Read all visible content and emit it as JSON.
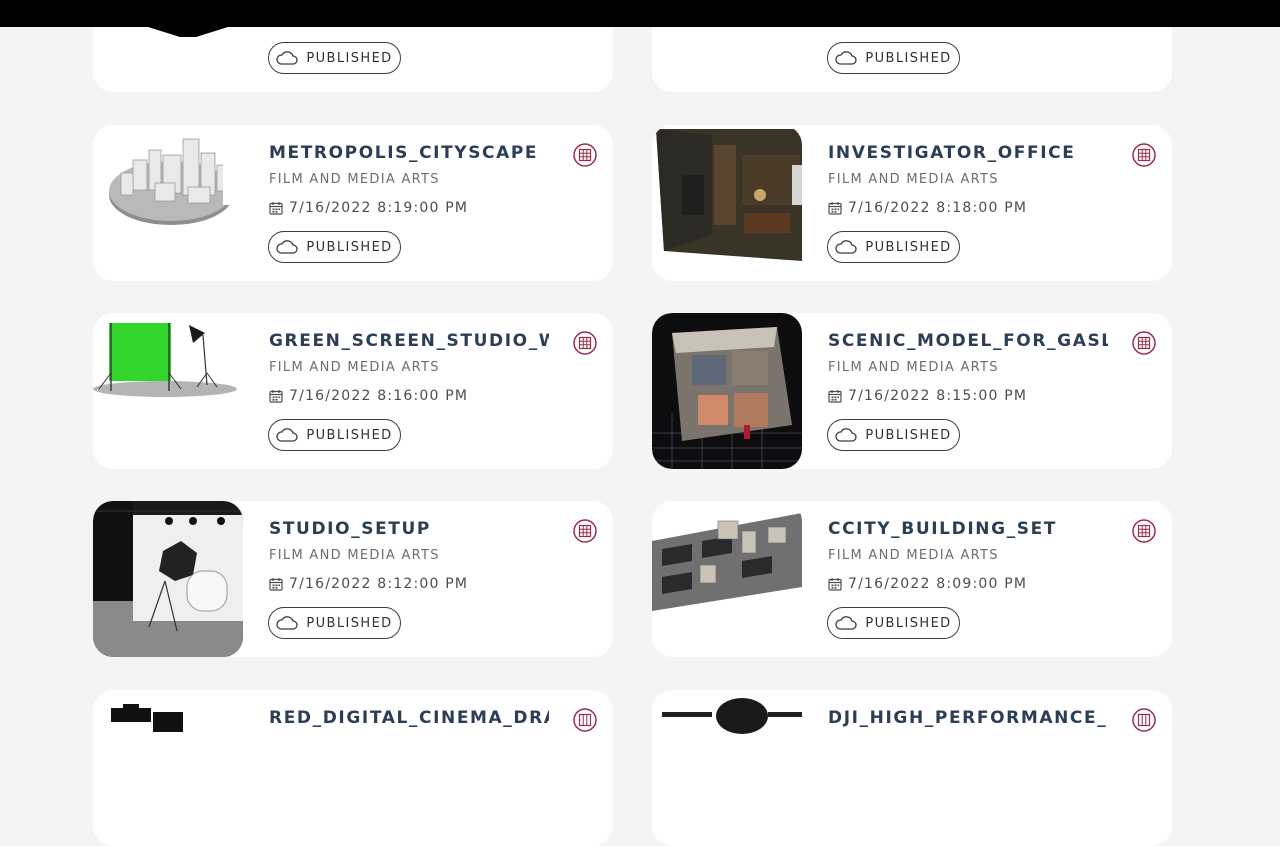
{
  "colors": {
    "page_bg": "#f4f4f5",
    "card_bg": "#ffffff",
    "title": "#2c3e55",
    "accent_icon": "#9b2b4a"
  },
  "status_label": "PUBLISHED",
  "items": [
    {
      "title": "",
      "category": "",
      "date": "",
      "status": "PUBLISHED"
    },
    {
      "title": "",
      "category": "",
      "date": "",
      "status": "PUBLISHED"
    },
    {
      "title": "METROPOLIS_CITYSCAPE",
      "category": "FILM AND MEDIA ARTS",
      "date": "7/16/2022 8:19:00 PM",
      "status": "PUBLISHED",
      "thumb_icon": "city-model-thumbnail"
    },
    {
      "title": "INVESTIGATOR_OFFICE",
      "category": "FILM AND MEDIA ARTS",
      "date": "7/16/2022 8:18:00 PM",
      "status": "PUBLISHED",
      "thumb_icon": "office-room-thumbnail"
    },
    {
      "title": "GREEN_SCREEN_STUDIO_W...",
      "category": "FILM AND MEDIA ARTS",
      "date": "7/16/2022 8:16:00 PM",
      "status": "PUBLISHED",
      "thumb_icon": "green-screen-thumbnail"
    },
    {
      "title": "SCENIC_MODEL_FOR_GASL...",
      "category": "FILM AND MEDIA ARTS",
      "date": "7/16/2022 8:15:00 PM",
      "status": "PUBLISHED",
      "thumb_icon": "scenic-model-thumbnail"
    },
    {
      "title": "STUDIO_SETUP",
      "category": "FILM AND MEDIA ARTS",
      "date": "7/16/2022 8:12:00 PM",
      "status": "PUBLISHED",
      "thumb_icon": "studio-setup-thumbnail"
    },
    {
      "title": "CCITY_BUILDING_SET",
      "category": "FILM AND MEDIA ARTS",
      "date": "7/16/2022 8:09:00 PM",
      "status": "PUBLISHED",
      "thumb_icon": "building-set-thumbnail"
    },
    {
      "title": "RED_DIGITAL_CINEMA_DRA...",
      "category": "",
      "date": "",
      "status": "",
      "thumb_icon": "camera-thumbnail"
    },
    {
      "title": "DJI_HIGH_PERFORMANCE_D...",
      "category": "",
      "date": "",
      "status": "",
      "thumb_icon": "drone-thumbnail"
    }
  ]
}
